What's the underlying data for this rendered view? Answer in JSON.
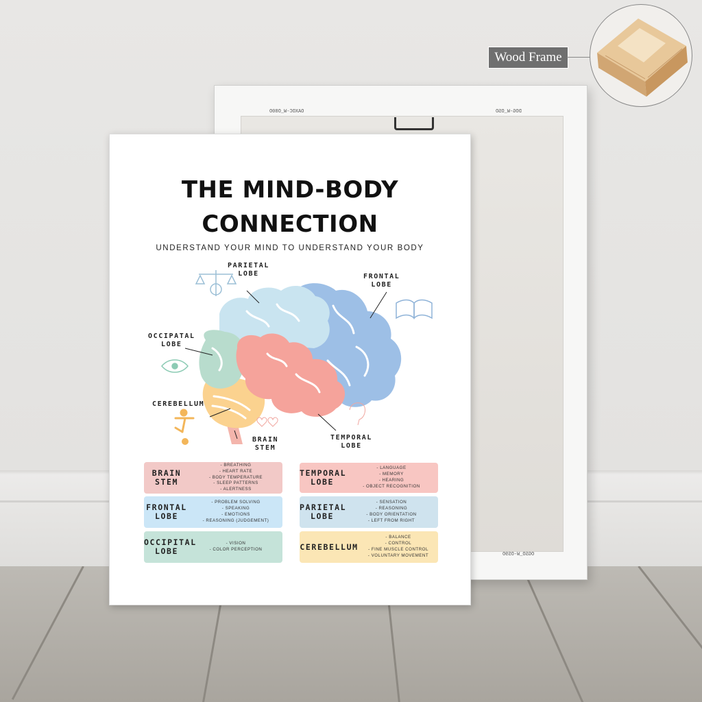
{
  "callout": {
    "label": "Wood Frame"
  },
  "frame": {
    "codes": [
      "OAXOC-W_O80O",
      "DOG-W_OSO",
      "OGSO_W-OS9O"
    ]
  },
  "poster": {
    "title_line1": "THE MIND-BODY",
    "title_line2": "CONNECTION",
    "subtitle": "UNDERSTAND YOUR MIND TO UNDERSTAND YOUR BODY",
    "labels": {
      "parietal": [
        "PARIETAL",
        "LOBE"
      ],
      "frontal": [
        "FRONTAL",
        "LOBE"
      ],
      "occipital": [
        "OCCIPATAL",
        "LOBE"
      ],
      "cerebellum": "CEREBELLUM",
      "brainstem": [
        "BRAIN",
        "STEM"
      ],
      "temporal": [
        "TEMPORAL",
        "LOBE"
      ]
    },
    "boxes": [
      {
        "title": [
          "BRAIN",
          "STEM"
        ],
        "color": "#f2c9c7",
        "items": [
          "BREATHING",
          "HEART RATE",
          "BODY TEMPERATURE",
          "SLEEP PATTERNS",
          "ALERTNESS"
        ]
      },
      {
        "title": [
          "TEMPORAL",
          "LOBE"
        ],
        "color": "#f8c6c2",
        "items": [
          "LANGUAGE",
          "MEMORY",
          "HEARING",
          "OBJECT RECOGNITION"
        ]
      },
      {
        "title": [
          "FRONTAL",
          "LOBE"
        ],
        "color": "#cbe6f7",
        "items": [
          "PROBLEM SOLVING",
          "SPEAKING",
          "EMOTIONS",
          "REASONING (JUDGEMENT)"
        ]
      },
      {
        "title": [
          "PARIETAL",
          "LOBE"
        ],
        "color": "#cfe3ee",
        "items": [
          "SENSATION",
          "REASONING",
          "BODY ORIENTATION",
          "LEFT FROM RIGHT"
        ]
      },
      {
        "title": [
          "OCCIPITAL",
          "LOBE"
        ],
        "color": "#c5e3d9",
        "items": [
          "VISION",
          "COLOR PERCEPTION"
        ]
      },
      {
        "title": [
          "CEREBELLUM"
        ],
        "color": "#fbe6b5",
        "items": [
          "BALANCE",
          "CONTROL",
          "FINE MUSCLE CONTROL",
          "VOLUNTARY MOVEMENT"
        ]
      }
    ],
    "colors": {
      "parietal": "#c9e4f0",
      "frontal": "#9dbfe6",
      "occipital": "#b8dccd",
      "temporal": "#f5a39b",
      "cerebellum": "#fbd28f",
      "brainstem": "#f4b5ac"
    }
  }
}
